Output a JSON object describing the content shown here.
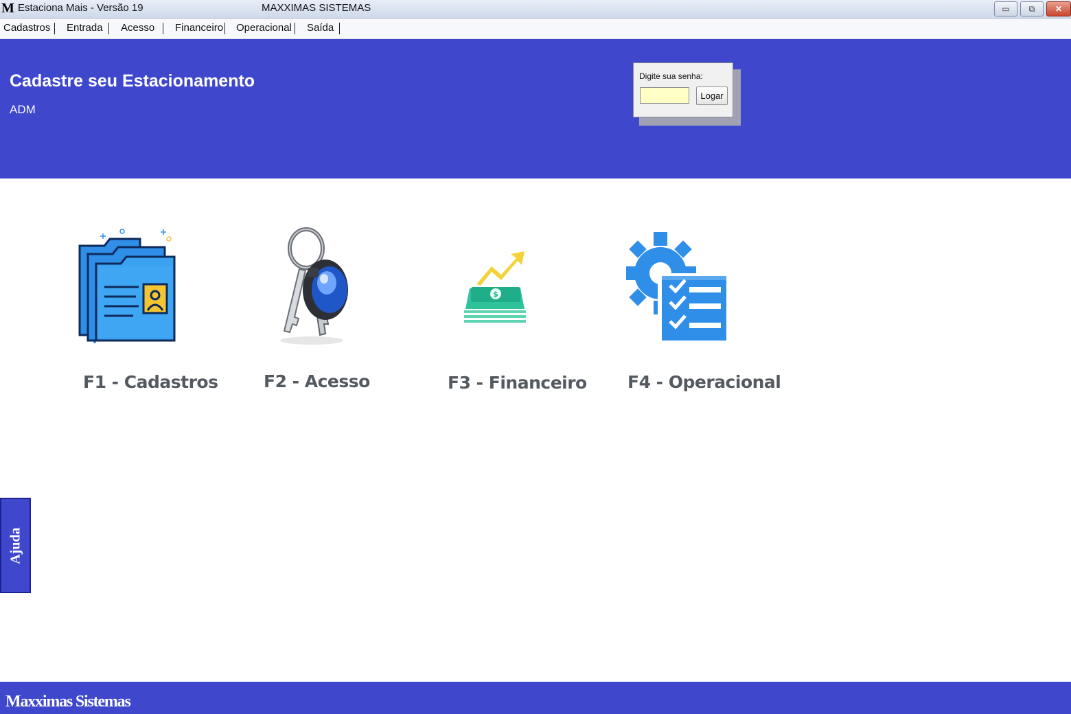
{
  "window": {
    "logo_letter": "M",
    "title": "Estaciona Mais - Versão 19",
    "company": "MAXXIMAS SISTEMAS",
    "controls": {
      "minimize": "▭",
      "maximize": "⧉",
      "close": "✕"
    }
  },
  "menu": {
    "items": [
      "Cadastros",
      "Entrada",
      "Acesso",
      "Financeiro",
      "Operacional",
      "Saída"
    ]
  },
  "header": {
    "title": "Cadastre seu Estacionamento",
    "user": "ADM"
  },
  "login": {
    "label": "Digite sua senha:",
    "password_value": "",
    "button": "Logar"
  },
  "tiles": [
    {
      "label": "F1 - Cadastros",
      "icon": "folders-icon"
    },
    {
      "label": "F2 - Acesso",
      "icon": "keys-icon"
    },
    {
      "label": "F3 - Financeiro",
      "icon": "money-icon"
    },
    {
      "label": "F4 - Operacional",
      "icon": "gear-checklist-icon"
    }
  ],
  "help": {
    "label": "Ajuda"
  },
  "footer": {
    "label": "Maxximas Sistemas"
  },
  "colors": {
    "brand_blue": "#3f48cc",
    "icon_blue": "#2f8ee8",
    "money_green": "#2fc39b",
    "arrow_yellow": "#f3d23a"
  }
}
